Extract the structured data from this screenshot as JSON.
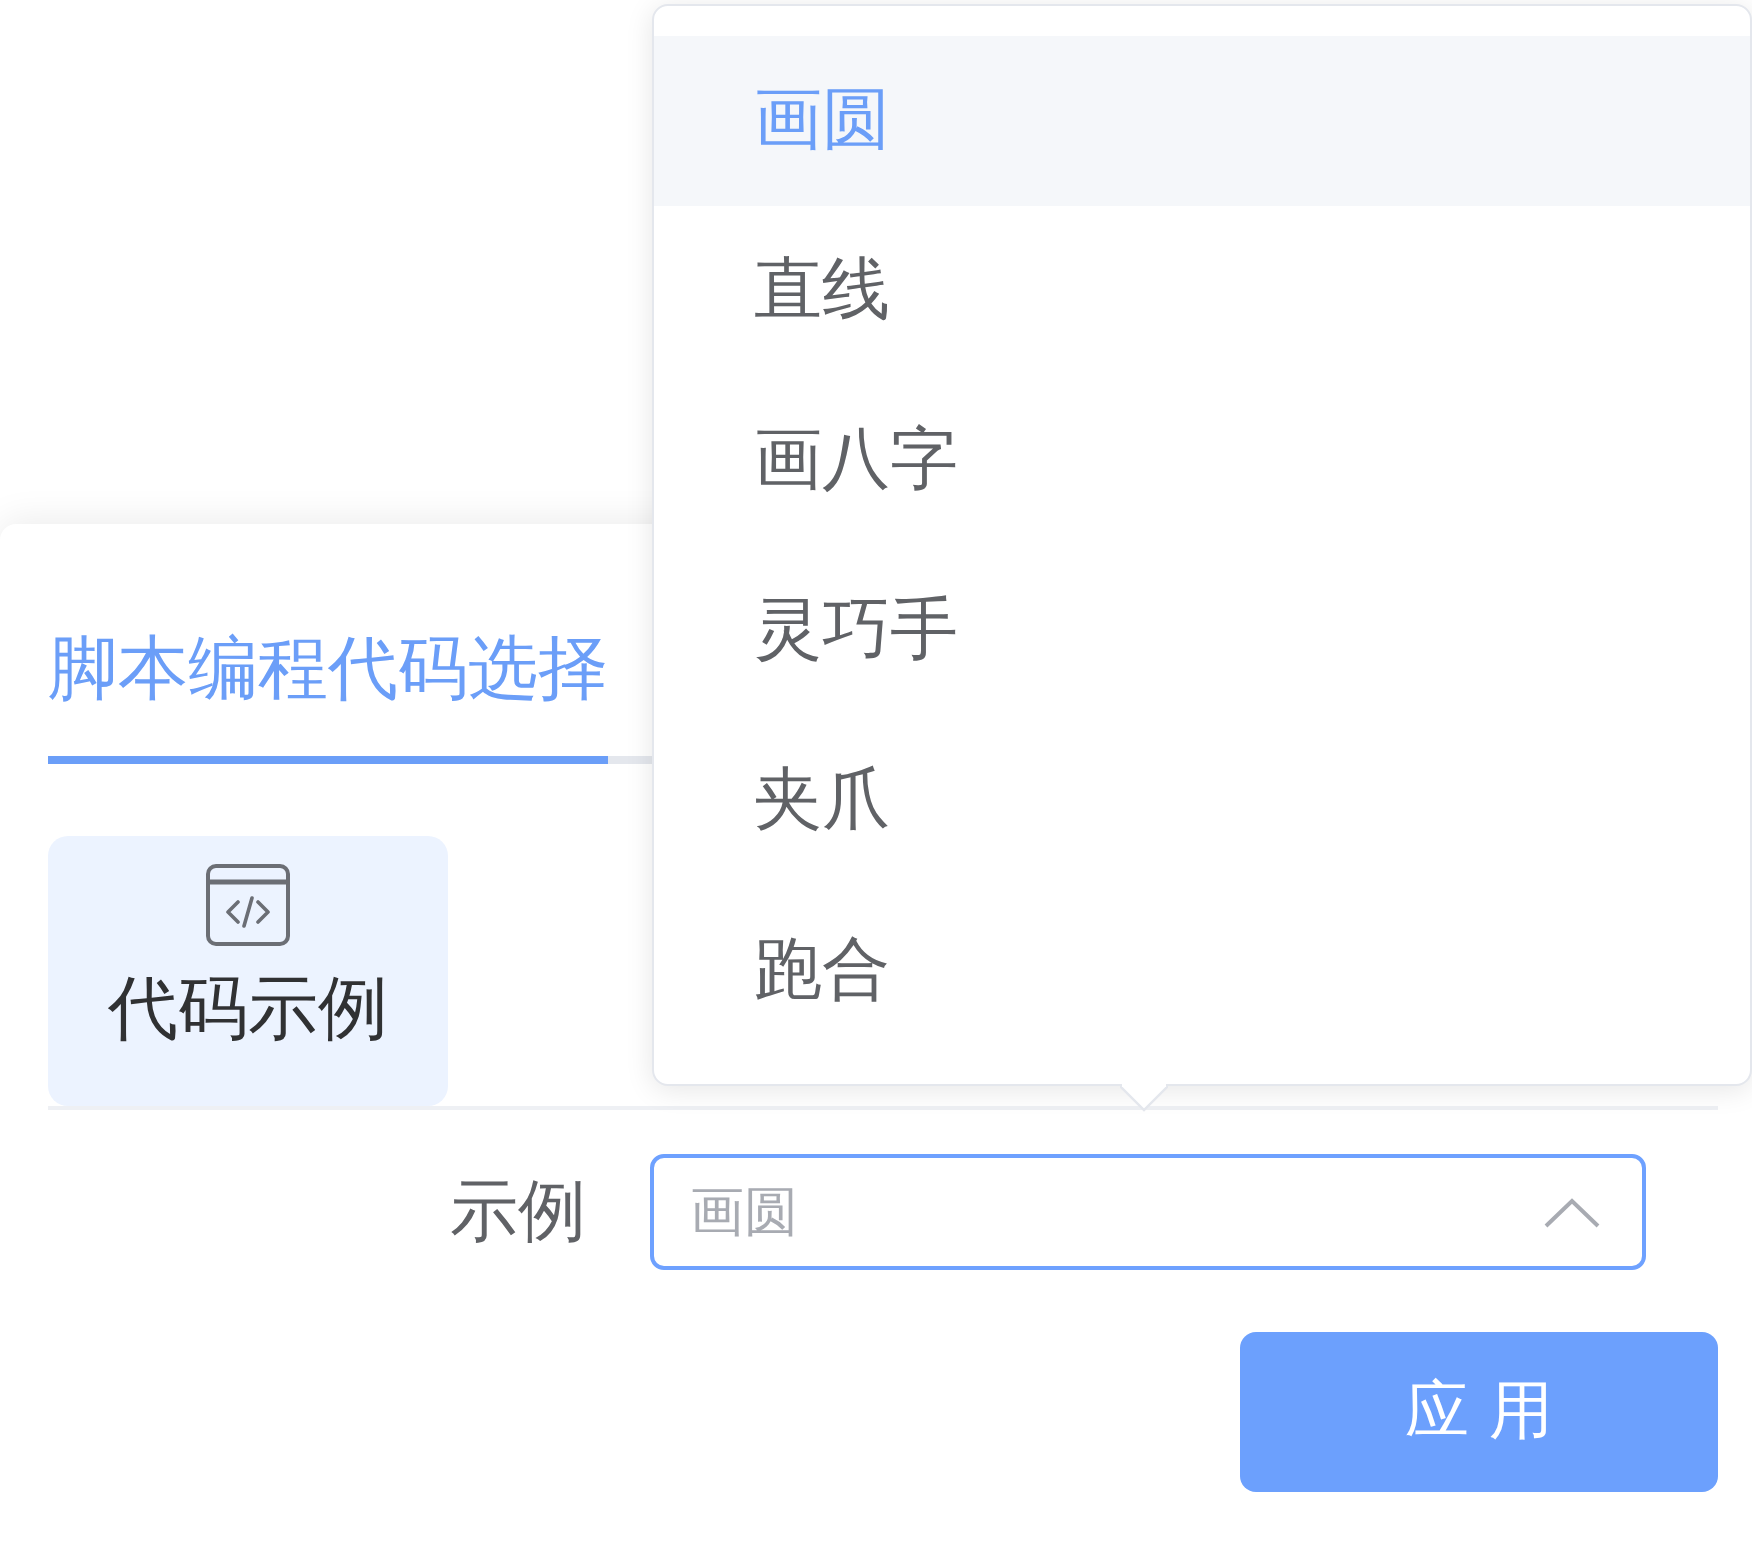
{
  "tabs": [
    {
      "label": "脚本编程代码选择",
      "selected": true
    }
  ],
  "categories": [
    {
      "label": "代码示例",
      "selected": true
    }
  ],
  "form": {
    "label": "示例",
    "select": {
      "placeholder": "画圆",
      "expanded": true
    }
  },
  "dropdown": {
    "options": [
      {
        "label": "画圆",
        "selected": true
      },
      {
        "label": "直线",
        "selected": false
      },
      {
        "label": "画八字",
        "selected": false
      },
      {
        "label": "灵巧手",
        "selected": false
      },
      {
        "label": "夹爪",
        "selected": false
      },
      {
        "label": "跑合",
        "selected": false
      }
    ]
  },
  "buttons": [
    {
      "label": "应用"
    }
  ]
}
